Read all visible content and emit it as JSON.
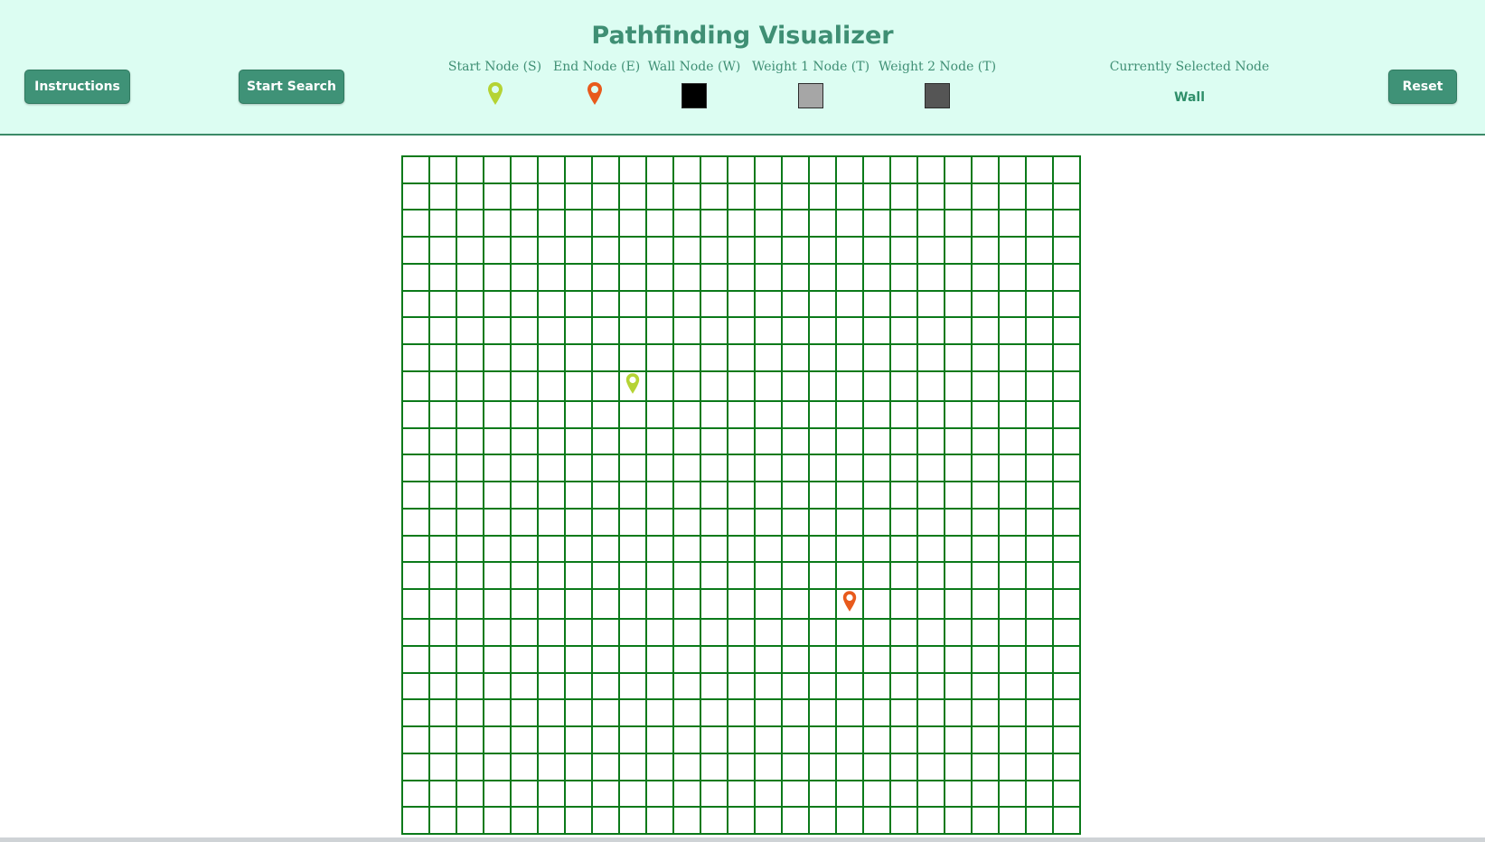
{
  "app": {
    "title": "Pathfinding Visualizer"
  },
  "toolbar": {
    "instructions_label": "Instructions",
    "start_search_label": "Start Search",
    "reset_label": "Reset"
  },
  "legend": [
    {
      "label": "Start Node (S)",
      "icon": "map-pin-icon",
      "color": "#b5d334"
    },
    {
      "label": "End Node (E)",
      "icon": "map-pin-icon",
      "color": "#e85a1c"
    },
    {
      "label": "Wall Node (W)",
      "icon": "swatch",
      "color": "#000000"
    },
    {
      "label": "Weight 1 Node (T)",
      "icon": "swatch",
      "color": "#a6a6a6"
    },
    {
      "label": "Weight 2 Node (T)",
      "icon": "swatch",
      "color": "#555555"
    }
  ],
  "selected": {
    "title": "Currently Selected Node",
    "value": "Wall"
  },
  "grid": {
    "rows": 25,
    "cols": 25,
    "start": {
      "row": 8,
      "col": 8,
      "icon": "start-pin-icon",
      "color": "#b5d334"
    },
    "end": {
      "row": 16,
      "col": 16,
      "icon": "end-pin-icon",
      "color": "#e85a1c"
    }
  },
  "colors": {
    "header_bg": "#dcfdf2",
    "accent": "#3f9277",
    "grid_line": "#0b7a1a"
  }
}
